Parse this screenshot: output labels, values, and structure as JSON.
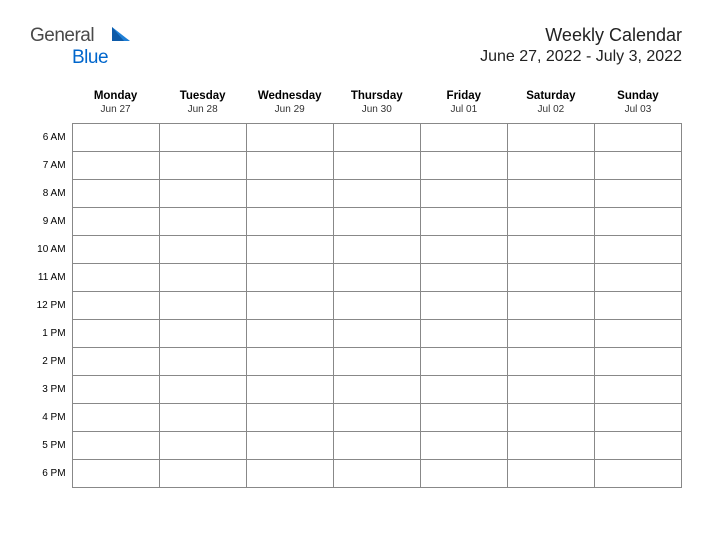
{
  "logo": {
    "text_part1": "General",
    "text_part2": "Blue"
  },
  "header": {
    "title": "Weekly Calendar",
    "date_range": "June 27, 2022 - July 3, 2022"
  },
  "days": [
    {
      "name": "Monday",
      "date": "Jun 27"
    },
    {
      "name": "Tuesday",
      "date": "Jun 28"
    },
    {
      "name": "Wednesday",
      "date": "Jun 29"
    },
    {
      "name": "Thursday",
      "date": "Jun 30"
    },
    {
      "name": "Friday",
      "date": "Jul 01"
    },
    {
      "name": "Saturday",
      "date": "Jul 02"
    },
    {
      "name": "Sunday",
      "date": "Jul 03"
    }
  ],
  "times": [
    "6 AM",
    "7 AM",
    "8 AM",
    "9 AM",
    "10 AM",
    "11 AM",
    "12 PM",
    "1 PM",
    "2 PM",
    "3 PM",
    "4 PM",
    "5 PM",
    "6 PM"
  ]
}
